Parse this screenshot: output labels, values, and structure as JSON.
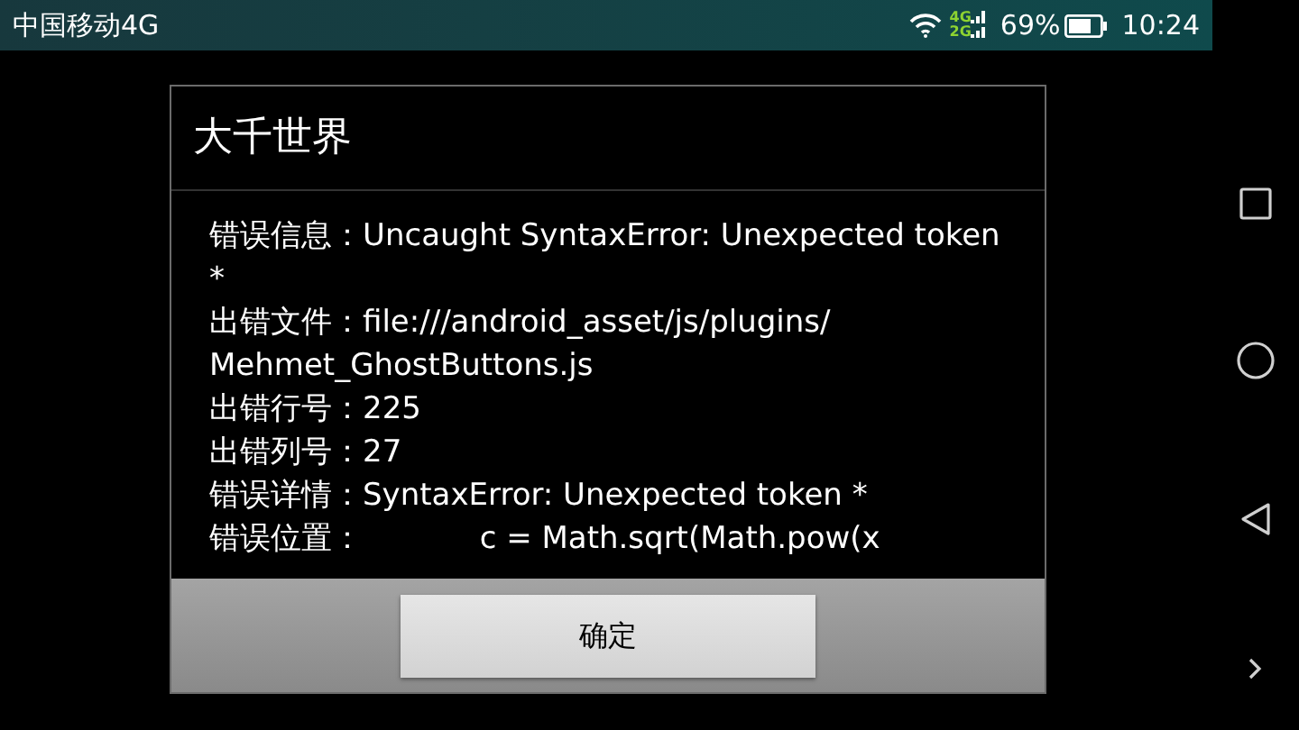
{
  "status_bar": {
    "carrier": "中国移动4G",
    "network_labels": [
      "4G",
      "2G"
    ],
    "battery": "69%",
    "time": "10:24"
  },
  "dialog": {
    "title": "大千世界",
    "entries": [
      {
        "label": "错误信息：",
        "value": "Uncaught SyntaxError: Unexpected token *"
      },
      {
        "label": "出错文件：",
        "value": "file:///android_asset/js/plugins/ Mehmet_GhostButtons.js"
      },
      {
        "label": "出错行号：",
        "value": "225"
      },
      {
        "label": "出错列号：",
        "value": "27"
      },
      {
        "label": "错误详情：",
        "value": "SyntaxError: Unexpected token *"
      },
      {
        "label": "错误位置：",
        "value": "            c = Math.sqrt(Math.pow(x"
      }
    ],
    "buttons": [
      "确定"
    ]
  }
}
